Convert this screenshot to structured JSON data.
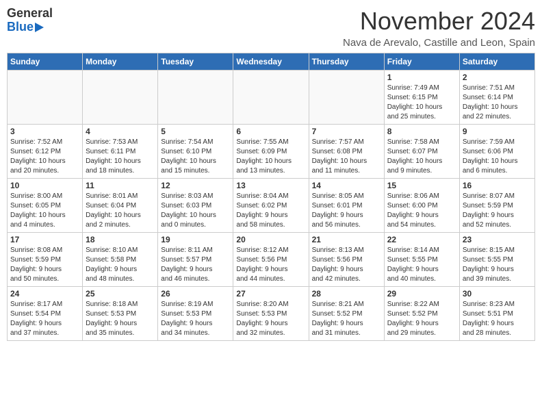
{
  "header": {
    "logo_line1": "General",
    "logo_line2": "Blue",
    "month_title": "November 2024",
    "location": "Nava de Arevalo, Castille and Leon, Spain"
  },
  "days_of_week": [
    "Sunday",
    "Monday",
    "Tuesday",
    "Wednesday",
    "Thursday",
    "Friday",
    "Saturday"
  ],
  "weeks": [
    [
      {
        "day": "",
        "info": ""
      },
      {
        "day": "",
        "info": ""
      },
      {
        "day": "",
        "info": ""
      },
      {
        "day": "",
        "info": ""
      },
      {
        "day": "",
        "info": ""
      },
      {
        "day": "1",
        "info": "Sunrise: 7:49 AM\nSunset: 6:15 PM\nDaylight: 10 hours\nand 25 minutes."
      },
      {
        "day": "2",
        "info": "Sunrise: 7:51 AM\nSunset: 6:14 PM\nDaylight: 10 hours\nand 22 minutes."
      }
    ],
    [
      {
        "day": "3",
        "info": "Sunrise: 7:52 AM\nSunset: 6:12 PM\nDaylight: 10 hours\nand 20 minutes."
      },
      {
        "day": "4",
        "info": "Sunrise: 7:53 AM\nSunset: 6:11 PM\nDaylight: 10 hours\nand 18 minutes."
      },
      {
        "day": "5",
        "info": "Sunrise: 7:54 AM\nSunset: 6:10 PM\nDaylight: 10 hours\nand 15 minutes."
      },
      {
        "day": "6",
        "info": "Sunrise: 7:55 AM\nSunset: 6:09 PM\nDaylight: 10 hours\nand 13 minutes."
      },
      {
        "day": "7",
        "info": "Sunrise: 7:57 AM\nSunset: 6:08 PM\nDaylight: 10 hours\nand 11 minutes."
      },
      {
        "day": "8",
        "info": "Sunrise: 7:58 AM\nSunset: 6:07 PM\nDaylight: 10 hours\nand 9 minutes."
      },
      {
        "day": "9",
        "info": "Sunrise: 7:59 AM\nSunset: 6:06 PM\nDaylight: 10 hours\nand 6 minutes."
      }
    ],
    [
      {
        "day": "10",
        "info": "Sunrise: 8:00 AM\nSunset: 6:05 PM\nDaylight: 10 hours\nand 4 minutes."
      },
      {
        "day": "11",
        "info": "Sunrise: 8:01 AM\nSunset: 6:04 PM\nDaylight: 10 hours\nand 2 minutes."
      },
      {
        "day": "12",
        "info": "Sunrise: 8:03 AM\nSunset: 6:03 PM\nDaylight: 10 hours\nand 0 minutes."
      },
      {
        "day": "13",
        "info": "Sunrise: 8:04 AM\nSunset: 6:02 PM\nDaylight: 9 hours\nand 58 minutes."
      },
      {
        "day": "14",
        "info": "Sunrise: 8:05 AM\nSunset: 6:01 PM\nDaylight: 9 hours\nand 56 minutes."
      },
      {
        "day": "15",
        "info": "Sunrise: 8:06 AM\nSunset: 6:00 PM\nDaylight: 9 hours\nand 54 minutes."
      },
      {
        "day": "16",
        "info": "Sunrise: 8:07 AM\nSunset: 5:59 PM\nDaylight: 9 hours\nand 52 minutes."
      }
    ],
    [
      {
        "day": "17",
        "info": "Sunrise: 8:08 AM\nSunset: 5:59 PM\nDaylight: 9 hours\nand 50 minutes."
      },
      {
        "day": "18",
        "info": "Sunrise: 8:10 AM\nSunset: 5:58 PM\nDaylight: 9 hours\nand 48 minutes."
      },
      {
        "day": "19",
        "info": "Sunrise: 8:11 AM\nSunset: 5:57 PM\nDaylight: 9 hours\nand 46 minutes."
      },
      {
        "day": "20",
        "info": "Sunrise: 8:12 AM\nSunset: 5:56 PM\nDaylight: 9 hours\nand 44 minutes."
      },
      {
        "day": "21",
        "info": "Sunrise: 8:13 AM\nSunset: 5:56 PM\nDaylight: 9 hours\nand 42 minutes."
      },
      {
        "day": "22",
        "info": "Sunrise: 8:14 AM\nSunset: 5:55 PM\nDaylight: 9 hours\nand 40 minutes."
      },
      {
        "day": "23",
        "info": "Sunrise: 8:15 AM\nSunset: 5:55 PM\nDaylight: 9 hours\nand 39 minutes."
      }
    ],
    [
      {
        "day": "24",
        "info": "Sunrise: 8:17 AM\nSunset: 5:54 PM\nDaylight: 9 hours\nand 37 minutes."
      },
      {
        "day": "25",
        "info": "Sunrise: 8:18 AM\nSunset: 5:53 PM\nDaylight: 9 hours\nand 35 minutes."
      },
      {
        "day": "26",
        "info": "Sunrise: 8:19 AM\nSunset: 5:53 PM\nDaylight: 9 hours\nand 34 minutes."
      },
      {
        "day": "27",
        "info": "Sunrise: 8:20 AM\nSunset: 5:53 PM\nDaylight: 9 hours\nand 32 minutes."
      },
      {
        "day": "28",
        "info": "Sunrise: 8:21 AM\nSunset: 5:52 PM\nDaylight: 9 hours\nand 31 minutes."
      },
      {
        "day": "29",
        "info": "Sunrise: 8:22 AM\nSunset: 5:52 PM\nDaylight: 9 hours\nand 29 minutes."
      },
      {
        "day": "30",
        "info": "Sunrise: 8:23 AM\nSunset: 5:51 PM\nDaylight: 9 hours\nand 28 minutes."
      }
    ]
  ]
}
